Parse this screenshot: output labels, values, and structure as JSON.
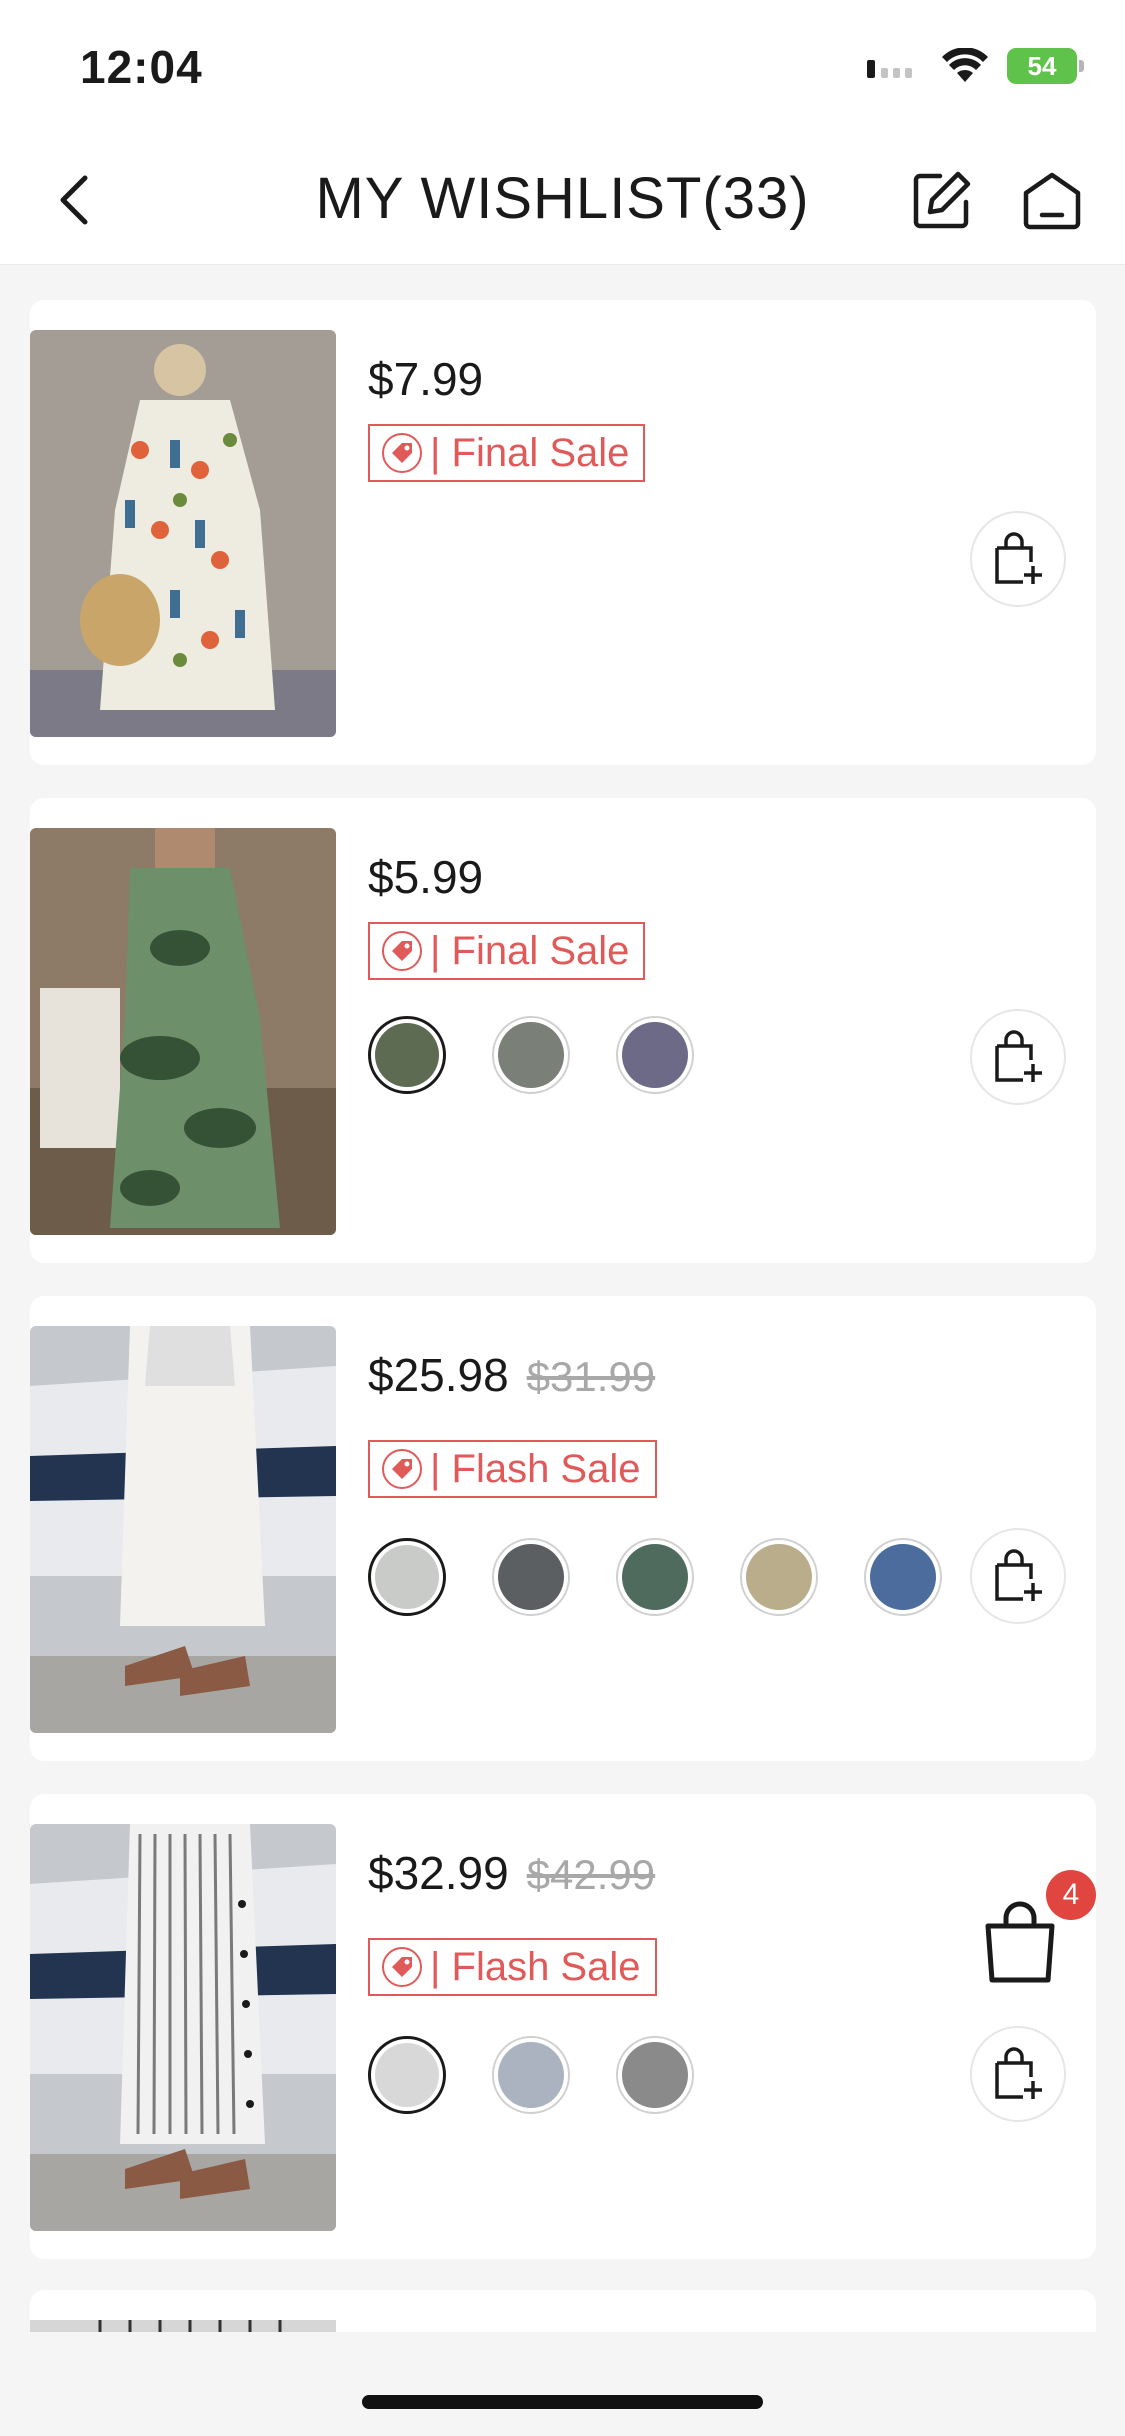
{
  "status_bar": {
    "time": "12:04",
    "battery": "54"
  },
  "header": {
    "title": "MY WISHLIST(33)"
  },
  "items": [
    {
      "price": "$7.99",
      "original_price": "",
      "tag": "| Final Sale",
      "swatch_colors": []
    },
    {
      "price": "$5.99",
      "original_price": "",
      "tag": "| Final Sale",
      "swatch_colors": [
        "#5d6b52",
        "#7a7f78",
        "#6c6a86"
      ]
    },
    {
      "price": "$25.98",
      "original_price": "$31.99",
      "tag": "| Flash Sale",
      "swatch_colors": [
        "#c9cbc8",
        "#5c5f61",
        "#4f6b5d",
        "#b9ad8c",
        "#4b6c9c"
      ]
    },
    {
      "price": "$32.99",
      "original_price": "$42.99",
      "tag": "| Flash Sale",
      "swatch_colors": [
        "#d8d8d8",
        "#aab3bf",
        "#8a8a8a"
      ]
    }
  ],
  "cart": {
    "badge_count": "4"
  },
  "colors": {
    "accent": "#e05a5a",
    "badge": "#e0453f"
  }
}
